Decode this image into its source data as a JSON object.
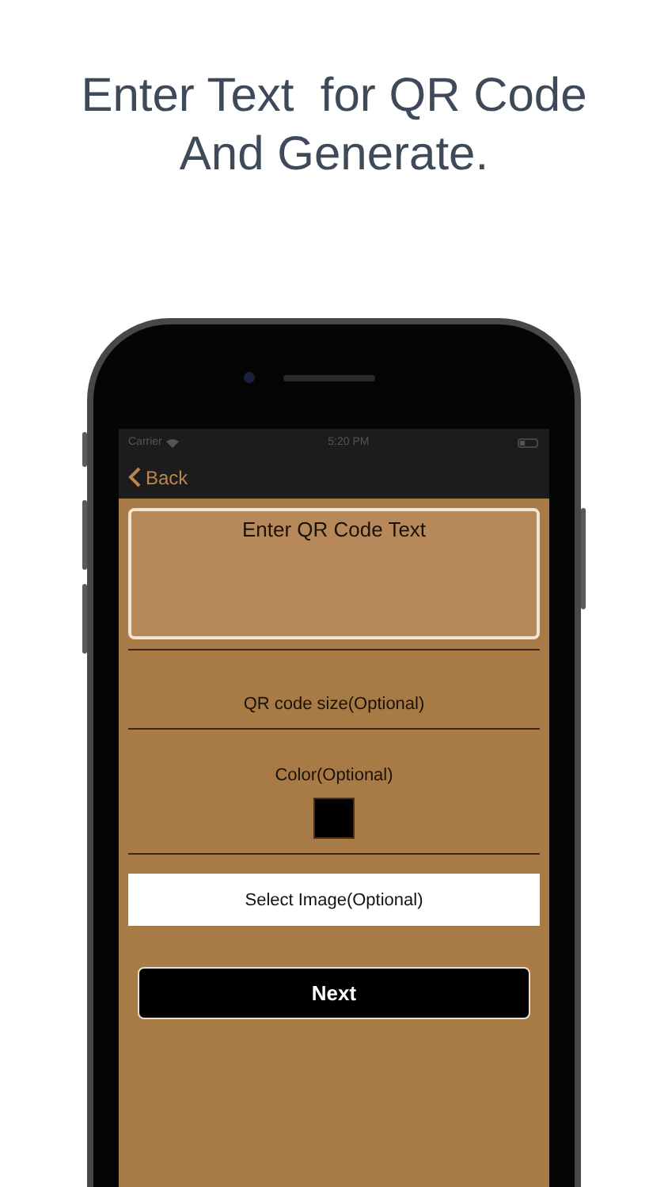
{
  "headline": [
    "Enter Text  for QR Code",
    "And Generate."
  ],
  "status_bar": {
    "carrier": "Carrier",
    "time": "5:20 PM"
  },
  "nav": {
    "back": "Back"
  },
  "form": {
    "text_field": {
      "placeholder": "Enter QR Code Text"
    },
    "size_label": "QR code size(Optional)",
    "color_label": "Color(Optional)",
    "color": "#000000",
    "image_button": "Select Image(Optional)",
    "next_button": "Next"
  }
}
